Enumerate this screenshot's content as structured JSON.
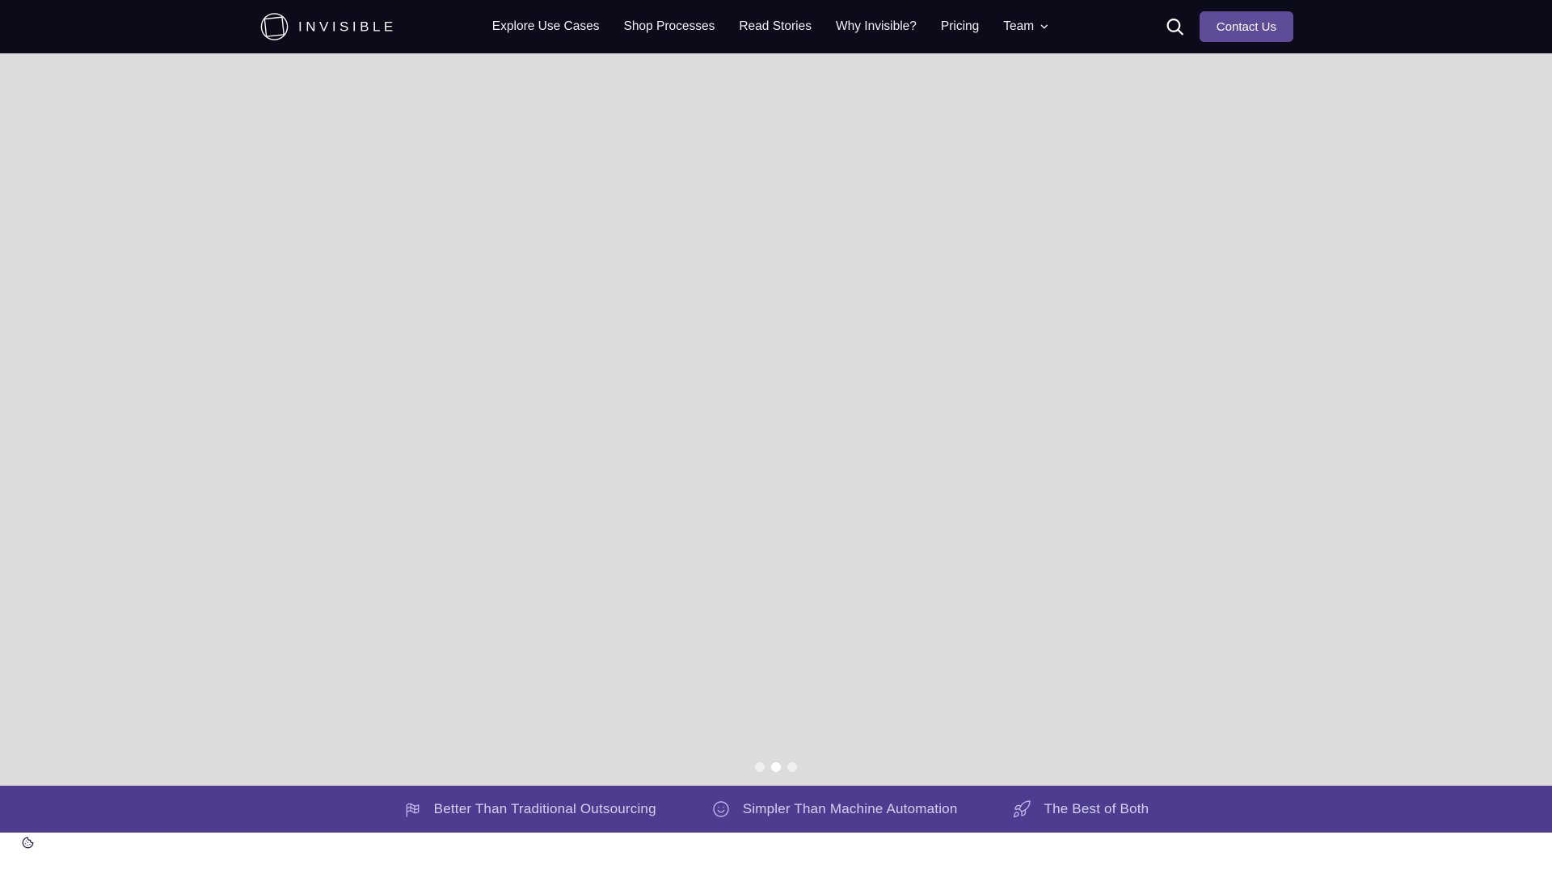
{
  "brand": {
    "wordmark": "INVISIBLE"
  },
  "nav": {
    "items": [
      {
        "label": "Explore Use Cases"
      },
      {
        "label": "Shop Processes"
      },
      {
        "label": "Read Stories"
      },
      {
        "label": "Why Invisible?"
      },
      {
        "label": "Pricing"
      },
      {
        "label": "Team",
        "has_dropdown": true
      }
    ]
  },
  "header": {
    "contact_button_label": "Contact Us"
  },
  "hero": {
    "carousel": {
      "dot_count": 3,
      "active_index": 1
    }
  },
  "value_banner": {
    "items": [
      {
        "icon": "flag-checkered-icon",
        "label": "Better Than Traditional Outsourcing"
      },
      {
        "icon": "smiley-icon",
        "label": "Simpler Than Machine Automation"
      },
      {
        "icon": "rocket-icon",
        "label": "The Best of Both"
      }
    ]
  },
  "colors": {
    "header_bg": "#0c0b1a",
    "accent_purple": "#5e4c98",
    "banner_bg": "#4d3c90",
    "hero_bg": "#dcdcdc",
    "banner_text": "#d7d1ef",
    "nav_text": "#f3f2f7"
  }
}
